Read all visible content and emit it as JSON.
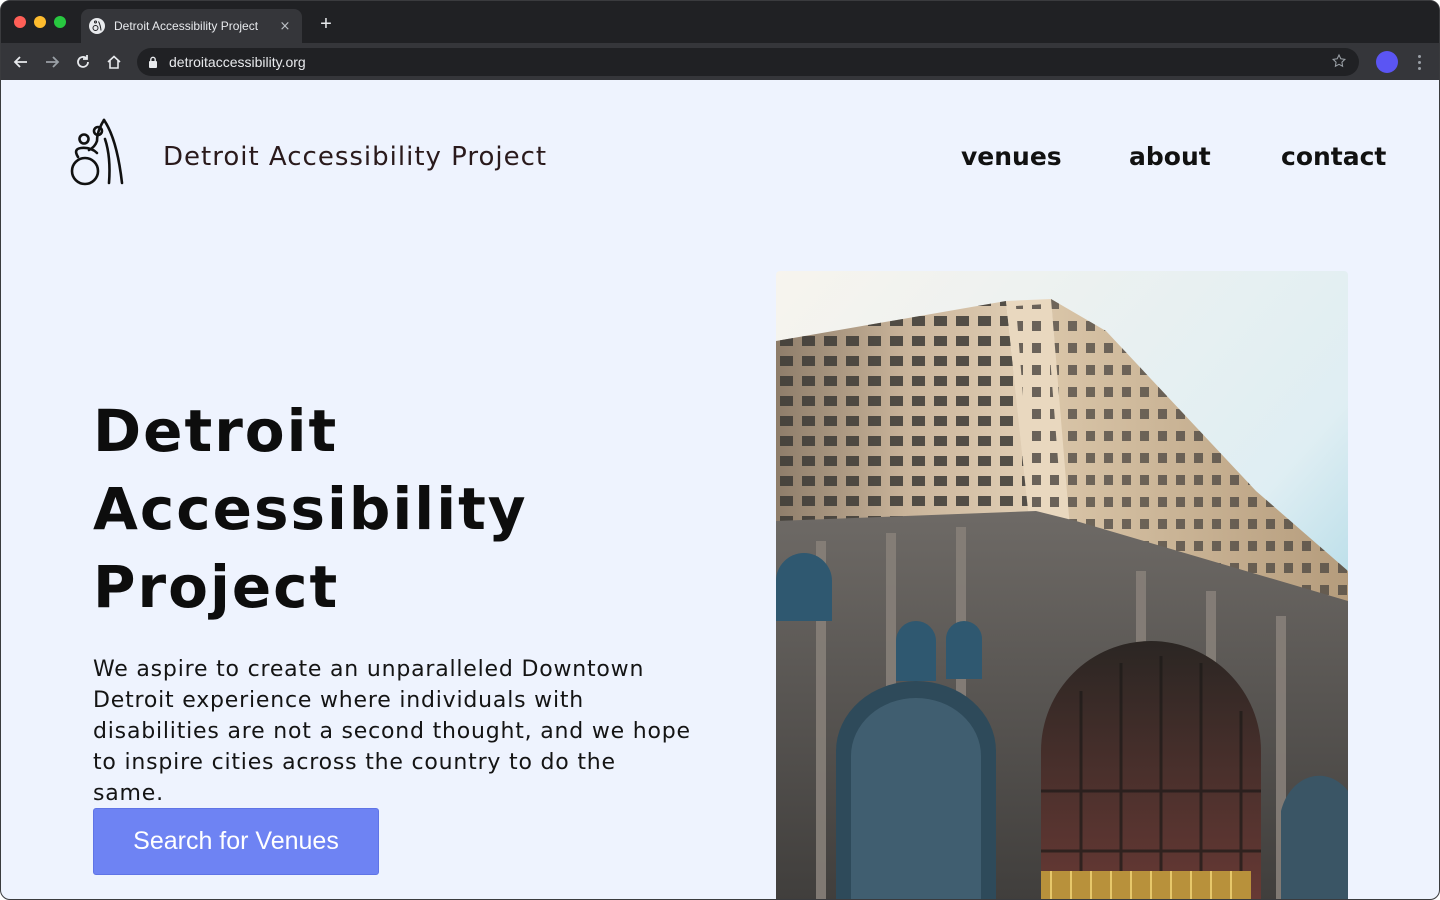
{
  "browser": {
    "tab": {
      "title": "Detroit Accessibility Project",
      "favicon": "wheelchair-icon",
      "close": "×"
    },
    "new_tab": "+",
    "url": "detroitaccessibility.org",
    "profile_color": "#5b55f3"
  },
  "site": {
    "title": "Detroit Accessibility Project",
    "logo": "wheelchair-dancer-logo",
    "nav": [
      "venues",
      "about",
      "contact"
    ]
  },
  "hero": {
    "title_lines": [
      "Detroit",
      "Accessibility",
      "Project"
    ],
    "description": "We aspire to create an unparalleled Downtown Detroit experience where individuals with disabilities are not a second thought, and we hope to inspire cities across the country to do the same.",
    "cta": "Search for Venues",
    "image": "art-deco-skyscraper-photo"
  },
  "colors": {
    "page_bg": "#eef3fe",
    "accent": "#6e83f3",
    "title_color": "#2a1a1c"
  }
}
